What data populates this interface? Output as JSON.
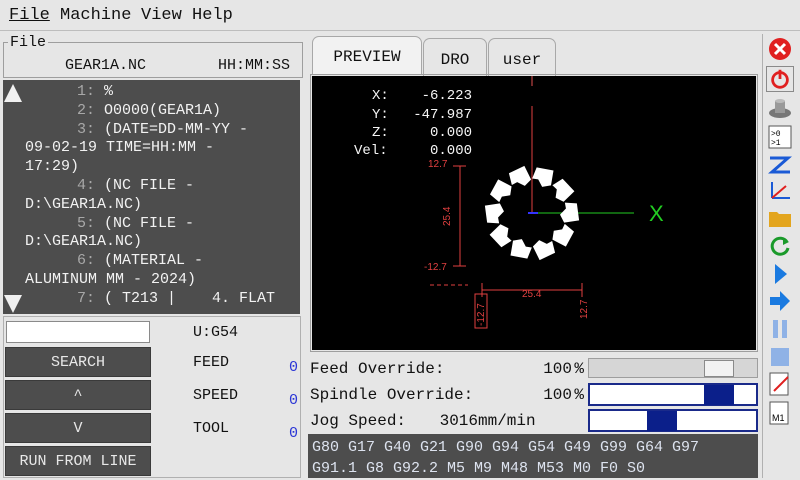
{
  "menu": [
    "File",
    "Machine",
    "View",
    "Help"
  ],
  "file_panel": {
    "legend": "File",
    "filename": "GEAR1A.NC",
    "time": "HH:MM:SS"
  },
  "gcode_lines": [
    {
      "num": "1:",
      "text": " %"
    },
    {
      "num": "2:",
      "text": " O0000(GEAR1A)"
    },
    {
      "num": "3:",
      "text": " (DATE=DD-MM-YY -"
    },
    {
      "num": "",
      "text": "09-02-19 TIME=HH:MM -"
    },
    {
      "num": "",
      "text": "17:29)"
    },
    {
      "num": "4:",
      "text": " (NC FILE -"
    },
    {
      "num": "",
      "text": "D:\\GEAR1A.NC)"
    },
    {
      "num": "5:",
      "text": " (NC FILE -"
    },
    {
      "num": "",
      "text": "D:\\GEAR1A.NC)"
    },
    {
      "num": "6:",
      "text": " (MATERIAL -"
    },
    {
      "num": "",
      "text": "ALUMINUM MM - 2024)"
    },
    {
      "num": "7:",
      "text": " ( T213 |    4. FLAT"
    }
  ],
  "search": {
    "value": ""
  },
  "buttons": {
    "search": "SEARCH",
    "up": "^",
    "down": "V",
    "run_from_line": "RUN FROM LINE"
  },
  "status": {
    "coord_system": "U:G54",
    "feed_label": "FEED",
    "feed_value": "0",
    "speed_label": "SPEED",
    "speed_value": "0",
    "tool_label": "TOOL",
    "tool_value": "0"
  },
  "tabs": [
    "PREVIEW",
    "DRO",
    "user"
  ],
  "dro": {
    "x_label": "X:",
    "x_value": "-6.223",
    "y_label": "Y:",
    "y_value": "-47.987",
    "z_label": "Z:",
    "z_value": "0.000",
    "vel_label": "Vel:",
    "vel_value": "0.000"
  },
  "preview_dims": {
    "top": "12.7",
    "side": "25.4",
    "bottom": "-12.7",
    "width": "25.4",
    "left_box": "-12.7",
    "right": "12.7",
    "axis_x": "X"
  },
  "overrides": {
    "feed_label": "Feed Override:",
    "feed_value": "100",
    "feed_unit": "%",
    "feed_level": 1.0,
    "spindle_label": "Spindle Override:",
    "spindle_value": "100",
    "spindle_unit": "%",
    "spindle_level": 1.0,
    "jog_label": "Jog Speed:",
    "jog_value": "3016",
    "jog_unit": "mm/min"
  },
  "gmodes": {
    "line1": "G80 G17 G40 G21 G90 G94 G54 G49 G99 G64 G97",
    "line2": "G91.1 G8 G92.2 M5 M9 M48 M53 M0 F0 S0"
  },
  "toolbar": [
    "estop-icon",
    "power-icon",
    "home-icon",
    "touchoff-icon",
    "path-icon",
    "axes-icon",
    "folder-icon",
    "reload-icon",
    "run-icon",
    "step-icon",
    "pause-icon",
    "stop-icon",
    "edit-icon",
    "m1-icon"
  ],
  "colors": {
    "accent": "#0b1f8a",
    "estop": "#e02020",
    "value_blue": "#2a35d6"
  }
}
